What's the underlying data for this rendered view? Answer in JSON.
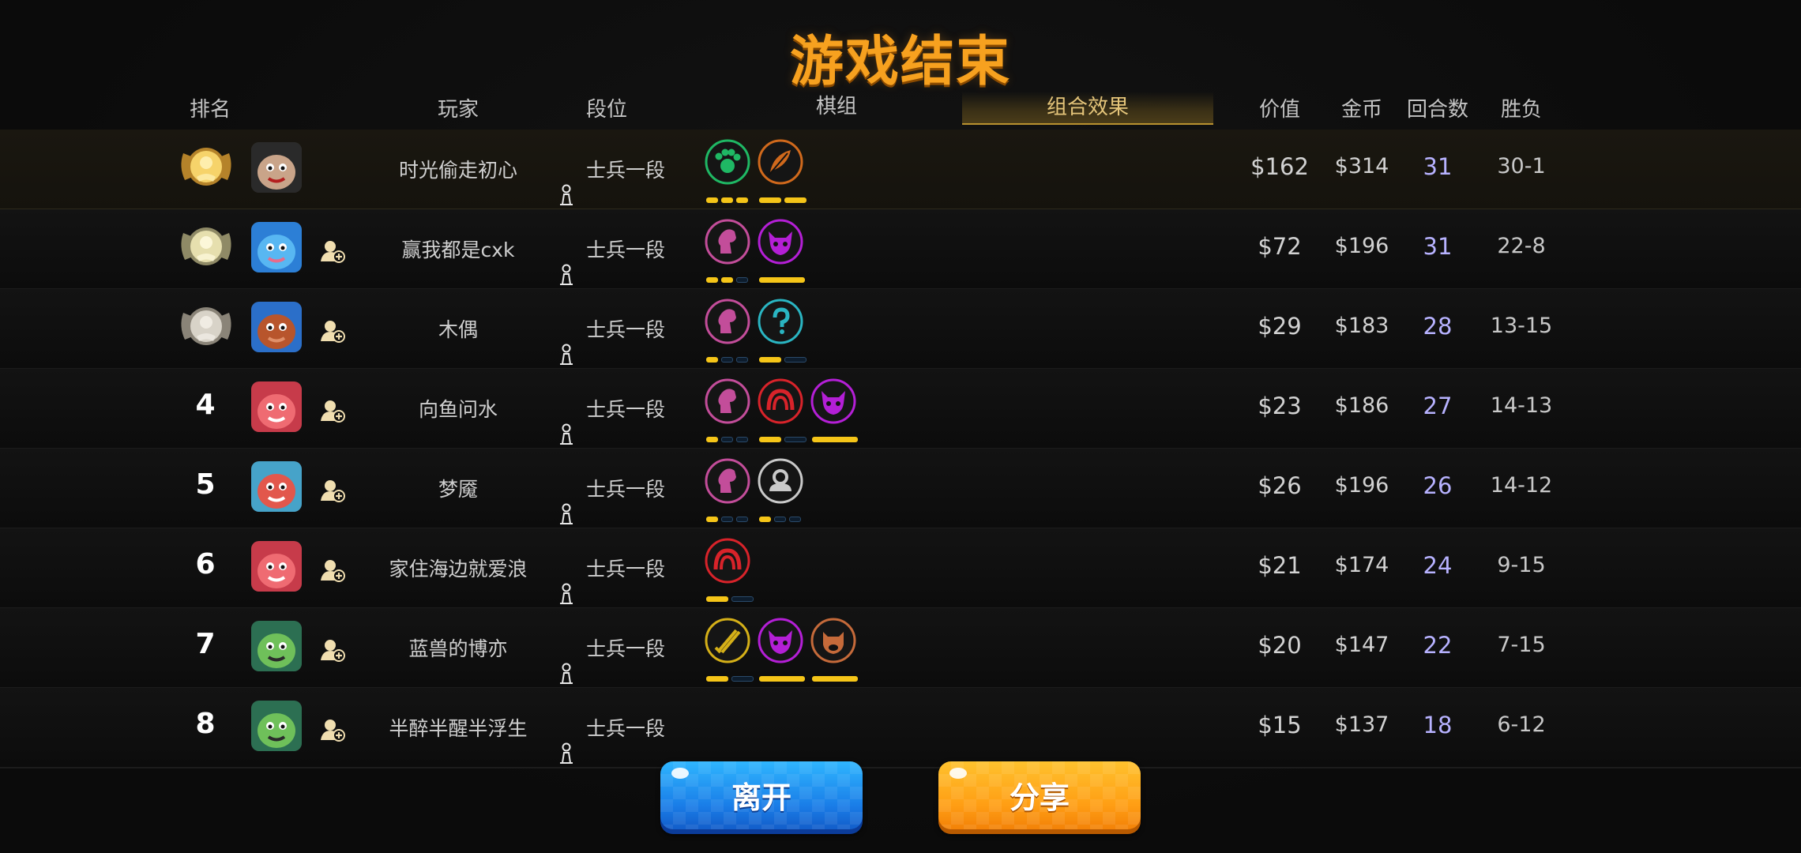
{
  "title": "游戏结束",
  "headers": {
    "rank": "排名",
    "player": "玩家",
    "tier": "段位",
    "lineup": "棋组",
    "synergy": "组合效果",
    "value": "价值",
    "gold": "金币",
    "rounds": "回合数",
    "win_loss": "胜负"
  },
  "active_tab": "synergy",
  "rows": [
    {
      "rank": "1",
      "medal": "gold",
      "avatar": "masked-bandit",
      "name": "时光偷走初心",
      "tier": "士兵一段",
      "value": "$162",
      "gold": "$314",
      "rounds": "31",
      "win_loss": "30-1",
      "self": true,
      "synergies": [
        {
          "icon": "paw",
          "color": "#1fb864",
          "pips": [
            1,
            1,
            1
          ]
        },
        {
          "icon": "feather",
          "color": "#d0691c",
          "pips": [
            1,
            1
          ]
        }
      ]
    },
    {
      "rank": "2",
      "medal": "silver",
      "avatar": "blue-bird",
      "name": "赢我都是cxk",
      "tier": "士兵一段",
      "value": "$72",
      "gold": "$196",
      "rounds": "31",
      "win_loss": "22-8",
      "synergies": [
        {
          "icon": "knight",
          "color": "#c34d9a",
          "pips": [
            1,
            1,
            0
          ]
        },
        {
          "icon": "demon",
          "color": "#b41fd6",
          "pips": [
            1
          ]
        }
      ]
    },
    {
      "rank": "3",
      "medal": "bronze",
      "avatar": "red-hair-girl",
      "name": "木偶",
      "tier": "士兵一段",
      "value": "$29",
      "gold": "$183",
      "rounds": "28",
      "win_loss": "13-15",
      "synergies": [
        {
          "icon": "knight",
          "color": "#c34d9a",
          "pips": [
            1,
            0,
            0
          ]
        },
        {
          "icon": "wizard",
          "color": "#2ab5c2",
          "pips": [
            1,
            0
          ]
        }
      ]
    },
    {
      "rank": "4",
      "medal": "",
      "avatar": "red-monster",
      "name": "向鱼问水",
      "tier": "士兵一段",
      "value": "$23",
      "gold": "$186",
      "rounds": "27",
      "win_loss": "14-13",
      "synergies": [
        {
          "icon": "knight",
          "color": "#c34d9a",
          "pips": [
            1,
            0,
            0
          ]
        },
        {
          "icon": "arch",
          "color": "#d8232a",
          "pips": [
            1,
            0
          ]
        },
        {
          "icon": "demon",
          "color": "#b41fd6",
          "pips": [
            1
          ]
        }
      ]
    },
    {
      "rank": "5",
      "medal": "",
      "avatar": "red-dragon",
      "name": "梦魇",
      "tier": "士兵一段",
      "value": "$26",
      "gold": "$196",
      "rounds": "26",
      "win_loss": "14-12",
      "synergies": [
        {
          "icon": "knight",
          "color": "#c34d9a",
          "pips": [
            1,
            0,
            0
          ]
        },
        {
          "icon": "human",
          "color": "#c9c9c9",
          "pips": [
            1,
            0,
            0
          ]
        }
      ]
    },
    {
      "rank": "6",
      "medal": "",
      "avatar": "red-monster",
      "name": "家住海边就爱浪",
      "tier": "士兵一段",
      "value": "$21",
      "gold": "$174",
      "rounds": "24",
      "win_loss": "9-15",
      "synergies": [
        {
          "icon": "arch",
          "color": "#d8232a",
          "pips": [
            1,
            0
          ]
        }
      ]
    },
    {
      "rank": "7",
      "medal": "",
      "avatar": "green-orc",
      "name": "蓝兽的博亦",
      "tier": "士兵一段",
      "value": "$20",
      "gold": "$147",
      "rounds": "22",
      "win_loss": "7-15",
      "synergies": [
        {
          "icon": "swords",
          "color": "#d5b018",
          "pips": [
            1,
            0
          ]
        },
        {
          "icon": "demon",
          "color": "#b41fd6",
          "pips": [
            1
          ]
        },
        {
          "icon": "boar",
          "color": "#c56a3a",
          "pips": [
            1
          ]
        }
      ]
    },
    {
      "rank": "8",
      "medal": "",
      "avatar": "green-orc",
      "name": "半醉半醒半浮生",
      "tier": "士兵一段",
      "value": "$15",
      "gold": "$137",
      "rounds": "18",
      "win_loss": "6-12",
      "synergies": []
    }
  ],
  "buttons": {
    "leave": "离开",
    "share": "分享"
  },
  "colors": {
    "title": "#f7a11f",
    "rounds": "#b7b2ff",
    "pip_on": "#f5c518",
    "leave_btn": "#1a7ee8",
    "share_btn": "#ff9e14"
  }
}
